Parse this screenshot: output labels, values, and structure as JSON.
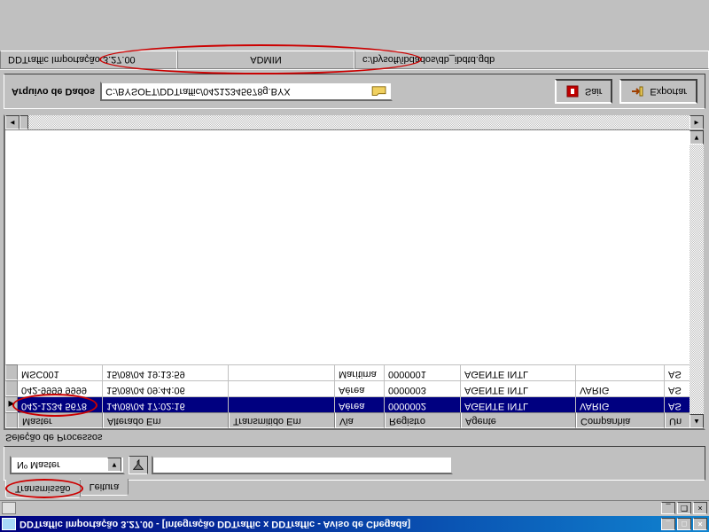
{
  "window": {
    "title": "DDTraffic Importação 3.27.00 - [Integração DDTraffic x DDTraffic - Aviso de Chegada]"
  },
  "tabs": {
    "transmissao": "Transmissão",
    "leitura": "Leitura"
  },
  "filter": {
    "combo_label": "Nº Master",
    "group_label": "Seleção de Processos"
  },
  "grid": {
    "header": {
      "master": "Master",
      "alterado": "Alterado Em",
      "trans": "Transmitido Em",
      "via": "Via",
      "registro": "Registro",
      "agente": "Agente",
      "companhia": "Companhia",
      "un": "Un"
    },
    "rows": [
      {
        "marker": "▶",
        "selected": true,
        "master": "042-1234 5678",
        "alterado": "14/08/04 17:02:16",
        "trans": "",
        "via": "Aérea",
        "registro": "0000002",
        "agente": "AGENTE INTL",
        "companhia": "VARIG",
        "un": "AS"
      },
      {
        "marker": "",
        "selected": false,
        "master": "042-9999 9999",
        "alterado": "15/08/04 09:44:06",
        "trans": "",
        "via": "Aérea",
        "registro": "0000003",
        "agente": "AGENTE INTL",
        "companhia": "VARIG",
        "un": "AS"
      },
      {
        "marker": "",
        "selected": false,
        "master": "MSC001",
        "alterado": "15/08/04 19:13:59",
        "trans": "",
        "via": "Marítima",
        "registro": "0000001",
        "agente": "AGENTE INTL",
        "companhia": "",
        "un": "AS"
      }
    ]
  },
  "bottom": {
    "label": "Arquivo de Dados",
    "path": "C:/BYSOFT/DDTraffic/04212345678g.BYX",
    "sair": "Sair",
    "exportar": "Exportar"
  },
  "status": {
    "right": "DDTraffic Importação 3.27.00",
    "center": "ADMIN",
    "left": "c:/bysoft/ibdados/db_ibdtd.gdb"
  }
}
